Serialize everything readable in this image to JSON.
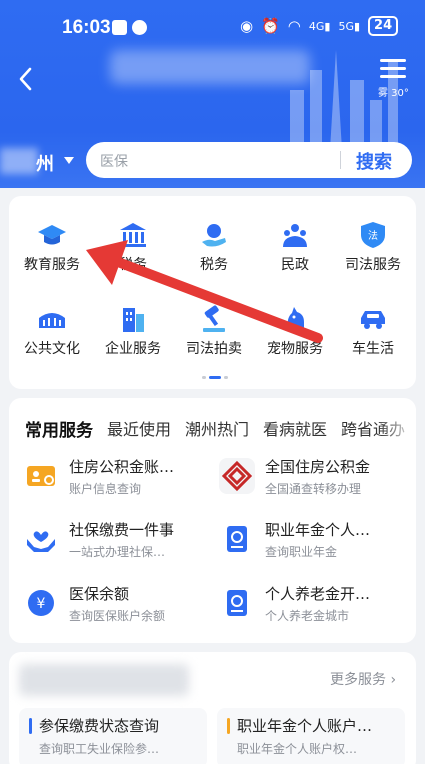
{
  "status_bar": {
    "time": "16:03",
    "battery": "24"
  },
  "header": {
    "weather": "雾 30°"
  },
  "location": {
    "city": "州"
  },
  "search": {
    "placeholder": "医保",
    "button_label": "搜索"
  },
  "grid": [
    {
      "label": "教育服务",
      "icon": "graduation-cap-icon"
    },
    {
      "label": "税务",
      "icon": "bank-building-icon"
    },
    {
      "label": "税务",
      "icon": "hand-service-icon"
    },
    {
      "label": "民政",
      "icon": "people-icon"
    },
    {
      "label": "司法服务",
      "icon": "law-shield-icon"
    },
    {
      "label": "公共文化",
      "icon": "stadium-icon"
    },
    {
      "label": "企业服务",
      "icon": "office-building-icon"
    },
    {
      "label": "司法拍卖",
      "icon": "gavel-icon"
    },
    {
      "label": "宠物服务",
      "icon": "pet-icon"
    },
    {
      "label": "车生活",
      "icon": "car-icon"
    }
  ],
  "tabs": [
    "常用服务",
    "最近使用",
    "潮州热门",
    "看病就医",
    "跨省通办"
  ],
  "services": [
    {
      "title": "住房公积金账…",
      "subtitle": "账户信息查询",
      "icon": "id-card-icon"
    },
    {
      "title": "全国住房公积金",
      "subtitle": "全国通查转移办理",
      "icon": "housing-fund-logo-icon"
    },
    {
      "title": "社保缴费一件事",
      "subtitle": "一站式办理社保…",
      "icon": "hands-heart-icon"
    },
    {
      "title": "职业年金个人…",
      "subtitle": "查询职业年金",
      "icon": "document-search-icon"
    },
    {
      "title": "医保余额",
      "subtitle": "查询医保账户余额",
      "icon": "yuan-coin-icon"
    },
    {
      "title": "个人养老金开…",
      "subtitle": "个人养老金城市",
      "icon": "document-search-icon"
    }
  ],
  "more": {
    "link_label": "更多服务",
    "items": [
      {
        "title": "参保缴费状态查询",
        "subtitle": "查询职工失业保险参…",
        "accent": "#2f6cf2"
      },
      {
        "title": "职业年金个人账户…",
        "subtitle": "职业年金个人账户权…",
        "accent": "#f5a623"
      }
    ]
  },
  "colors": {
    "primary": "#2f6cf2",
    "annotation_arrow": "#e53935"
  }
}
